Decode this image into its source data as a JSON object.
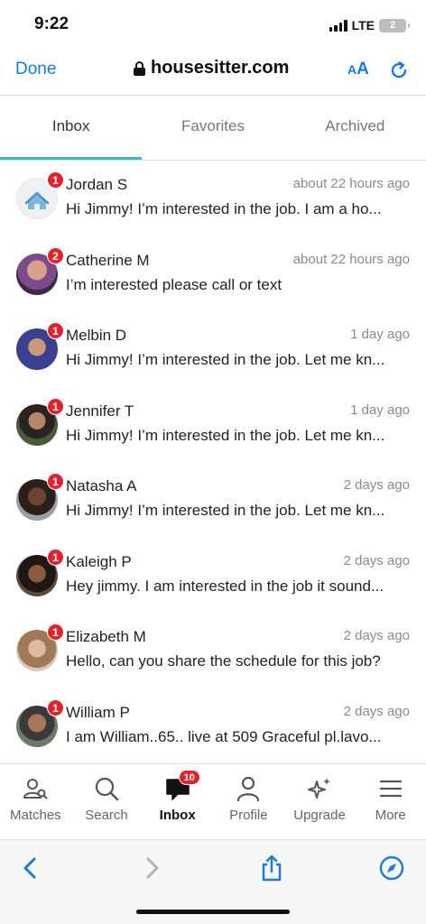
{
  "status_bar": {
    "time": "9:22",
    "network": "LTE",
    "battery": "2"
  },
  "browser": {
    "done_label": "Done",
    "url": "housesitter.com",
    "text_size_small": "A",
    "text_size_big": "A"
  },
  "tabs": [
    {
      "label": "Inbox",
      "active": true
    },
    {
      "label": "Favorites",
      "active": false
    },
    {
      "label": "Archived",
      "active": false
    }
  ],
  "messages": [
    {
      "name": "Jordan S",
      "time": "about 22 hours ago",
      "preview": "Hi Jimmy! I’m interested in the job. I am a ho...",
      "unread": "1",
      "avatar": "house-icon"
    },
    {
      "name": "Catherine M",
      "time": "about 22 hours ago",
      "preview": "I’m interested please call or text",
      "unread": "2",
      "avatar": "photo"
    },
    {
      "name": "Melbin D",
      "time": "1 day ago",
      "preview": "Hi Jimmy! I’m interested in the job. Let me kn...",
      "unread": "1",
      "avatar": "photo"
    },
    {
      "name": "Jennifer T",
      "time": "1 day ago",
      "preview": "Hi Jimmy! I’m interested in the job. Let me kn...",
      "unread": "1",
      "avatar": "photo"
    },
    {
      "name": "Natasha A",
      "time": "2 days ago",
      "preview": "Hi Jimmy! I’m interested in the job. Let me kn...",
      "unread": "1",
      "avatar": "photo"
    },
    {
      "name": "Kaleigh P",
      "time": "2 days ago",
      "preview": "Hey jimmy. I am interested in the job it sound...",
      "unread": "1",
      "avatar": "photo"
    },
    {
      "name": "Elizabeth M",
      "time": "2 days ago",
      "preview": "Hello, can you share the schedule for this job?",
      "unread": "1",
      "avatar": "photo"
    },
    {
      "name": "William P",
      "time": "2 days ago",
      "preview": "I am William..65.. live at 509 Graceful pl.lavo...",
      "unread": "1",
      "avatar": "photo"
    }
  ],
  "app_nav": {
    "items": [
      {
        "label": "Matches",
        "icon": "matches-icon"
      },
      {
        "label": "Search",
        "icon": "search-icon"
      },
      {
        "label": "Inbox",
        "icon": "inbox-icon",
        "active": true,
        "badge": "10"
      },
      {
        "label": "Profile",
        "icon": "profile-icon"
      },
      {
        "label": "Upgrade",
        "icon": "sparkle-icon"
      },
      {
        "label": "More",
        "icon": "menu-icon"
      }
    ]
  },
  "colors": {
    "accent": "#1a7bd6",
    "tab_underline": "#3cb8c6",
    "badge": "#e0242f"
  }
}
